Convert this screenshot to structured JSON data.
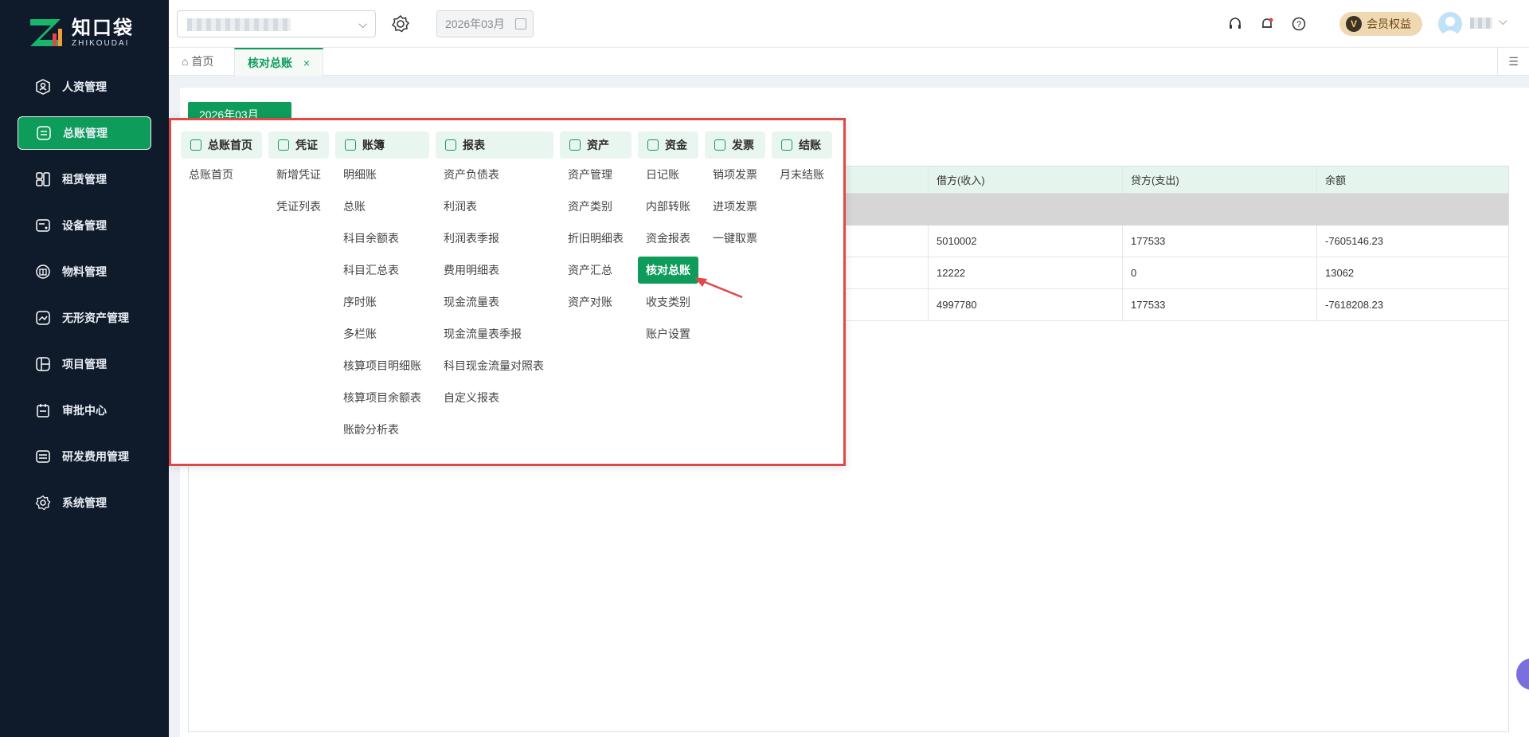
{
  "brand": {
    "name_cn": "知口袋",
    "name_en": "ZHIKOUDAI"
  },
  "sidebar": {
    "items": [
      {
        "label": "人资管理",
        "icon": "person-badge-icon"
      },
      {
        "label": "总账管理",
        "icon": "ledger-icon",
        "active": true
      },
      {
        "label": "租赁管理",
        "icon": "rental-icon"
      },
      {
        "label": "设备管理",
        "icon": "device-icon"
      },
      {
        "label": "物料管理",
        "icon": "box-icon"
      },
      {
        "label": "无形资产管理",
        "icon": "intangible-asset-icon"
      },
      {
        "label": "项目管理",
        "icon": "project-icon"
      },
      {
        "label": "审批中心",
        "icon": "approval-icon"
      },
      {
        "label": "研发费用管理",
        "icon": "rd-expense-icon"
      },
      {
        "label": "系统管理",
        "icon": "gear-icon"
      }
    ]
  },
  "topbar": {
    "period_value": "2026年03月",
    "vip_label": "会员权益",
    "vip_badge": "V"
  },
  "tabs": {
    "home": "首页",
    "active": "核对总账",
    "close": "×"
  },
  "content": {
    "period_button": "2026年03月",
    "table": {
      "columns": [
        "借方(收入)",
        "贷方(支出)",
        "余额"
      ],
      "rows": [
        [
          "5010002",
          "177533",
          "-7605146.23"
        ],
        [
          "12222",
          "0",
          "13062"
        ],
        [
          "4997780",
          "177533",
          "-7618208.23"
        ]
      ]
    }
  },
  "megamenu": {
    "columns": [
      {
        "title": "总账首页",
        "icon": "home-ledger-icon",
        "items": [
          "总账首页"
        ]
      },
      {
        "title": "凭证",
        "icon": "voucher-icon",
        "items": [
          "新增凭证",
          "凭证列表"
        ]
      },
      {
        "title": "账簿",
        "icon": "book-icon",
        "items": [
          "明细账",
          "总账",
          "科目余额表",
          "科目汇总表",
          "序时账",
          "多栏账",
          "核算项目明细账",
          "核算项目余额表",
          "账龄分析表"
        ]
      },
      {
        "title": "报表",
        "icon": "report-icon",
        "items": [
          "资产负债表",
          "利润表",
          "利润表季报",
          "费用明细表",
          "现金流量表",
          "现金流量表季报",
          "科目现金流量对照表",
          "自定义报表"
        ]
      },
      {
        "title": "资产",
        "icon": "asset-icon",
        "items": [
          "资产管理",
          "资产类别",
          "折旧明细表",
          "资产汇总",
          "资产对账"
        ]
      },
      {
        "title": "资金",
        "icon": "fund-icon",
        "items": [
          "日记账",
          "内部转账",
          "资金报表",
          "核对总账",
          "收支类别",
          "账户设置"
        ],
        "highlight": "核对总账"
      },
      {
        "title": "发票",
        "icon": "invoice-icon",
        "items": [
          "销项发票",
          "进项发票",
          "一键取票"
        ]
      },
      {
        "title": "结账",
        "icon": "checkout-icon",
        "items": [
          "月末结账"
        ]
      }
    ]
  },
  "colors": {
    "accent": "#0e9c5b",
    "sidebar_bg": "#0f1a2b",
    "highlight_border": "#e04848"
  }
}
